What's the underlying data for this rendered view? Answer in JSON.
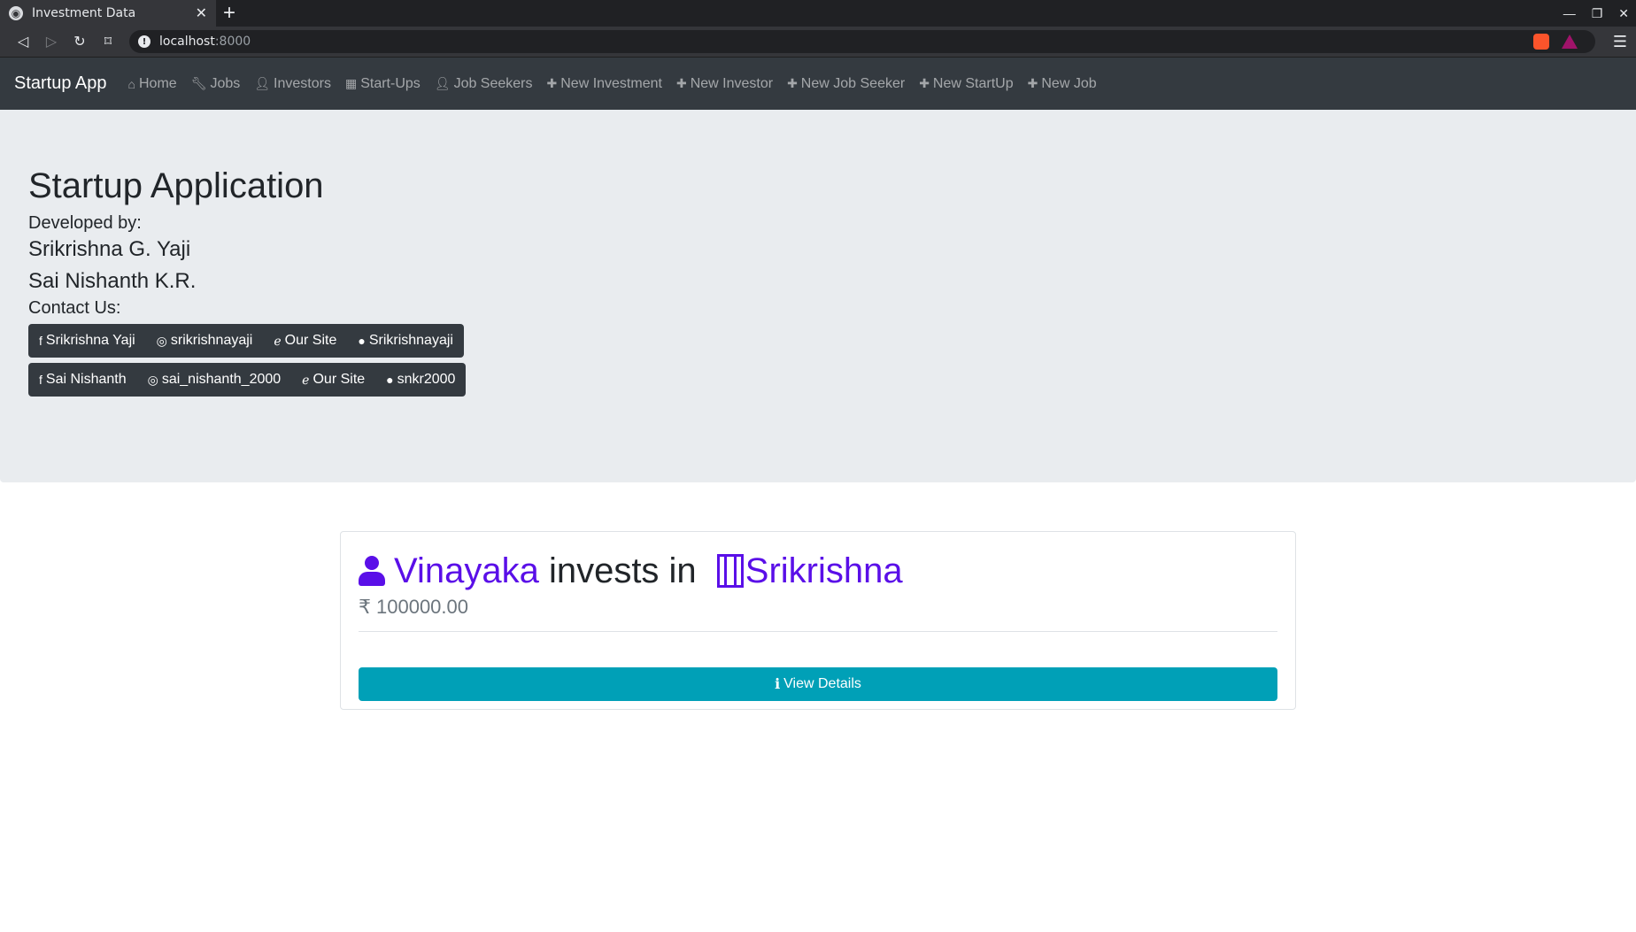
{
  "browser": {
    "tab_title": "Investment Data",
    "url_host": "localhost",
    "url_port": ":8000"
  },
  "navbar": {
    "brand": "Startup App",
    "items": [
      {
        "label": "Home",
        "icon": "home-icon"
      },
      {
        "label": "Jobs",
        "icon": "wrench-icon"
      },
      {
        "label": "Investors",
        "icon": "user-icon"
      },
      {
        "label": "Start-Ups",
        "icon": "building-icon"
      },
      {
        "label": "Job Seekers",
        "icon": "user-icon"
      },
      {
        "label": "New Investment",
        "icon": "plus-icon"
      },
      {
        "label": "New Investor",
        "icon": "plus-icon"
      },
      {
        "label": "New Job Seeker",
        "icon": "plus-icon"
      },
      {
        "label": "New StartUp",
        "icon": "plus-icon"
      },
      {
        "label": "New Job",
        "icon": "plus-icon"
      }
    ]
  },
  "jumbotron": {
    "title": "Startup Application",
    "developed_by": "Developed by:",
    "dev1": "Srikrishna G. Yaji",
    "dev2": "Sai Nishanth K.R.",
    "contact": "Contact Us:",
    "group1": [
      "Srikrishna Yaji",
      "srikrishnayaji",
      "Our Site",
      "Srikrishnayaji"
    ],
    "group2": [
      "Sai Nishanth",
      "sai_nishanth_2000",
      "Our Site",
      "snkr2000"
    ]
  },
  "card": {
    "investor": "Vinayaka",
    "middle": " invests in ",
    "startup": "Srikrishna",
    "amount": "100000.00",
    "button": "View Details"
  },
  "colors": {
    "navbar_bg": "#343a40",
    "jumbotron_bg": "#e9ecef",
    "link": "#5a0fe8",
    "info_button": "#00a0b7"
  }
}
